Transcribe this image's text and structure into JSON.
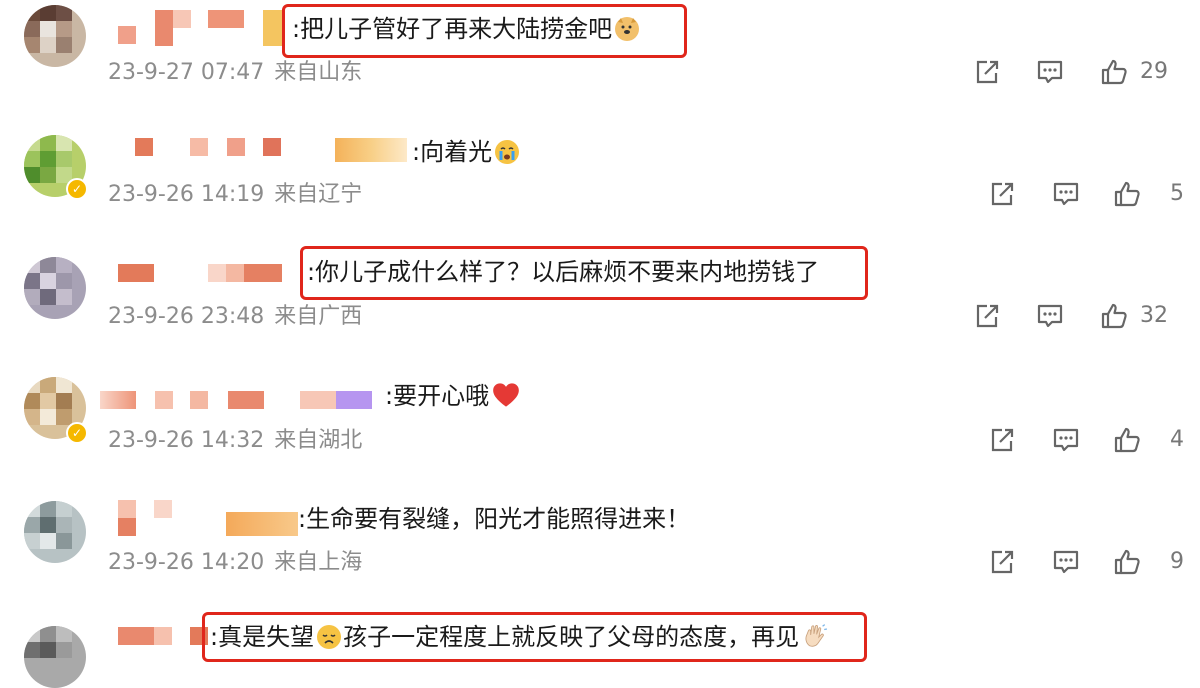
{
  "comments": [
    {
      "text": ":把儿子管好了再来大陆捞金吧",
      "emoji": "doge-emoji",
      "time": "23-9-27 07:47",
      "location": "来自山东",
      "likes": "29"
    },
    {
      "text": ":向着光",
      "emoji": "crying-face-emoji",
      "time": "23-9-26 14:19",
      "location": "来自辽宁",
      "likes": "5"
    },
    {
      "text": ":你儿子成什么样了？以后麻烦不要来内地捞钱了",
      "emoji": "",
      "time": "23-9-26 23:48",
      "location": "来自广西",
      "likes": "32"
    },
    {
      "text": ":要开心哦",
      "emoji": "red-heart-emoji",
      "time": "23-9-26 14:32",
      "location": "来自湖北",
      "likes": "4"
    },
    {
      "text": ":生命要有裂缝，阳光才能照得进来！",
      "emoji": "",
      "time": "23-9-26 14:20",
      "location": "来自上海",
      "likes": "9"
    },
    {
      "text_a": ":真是失望",
      "text_b": "孩子一定程度上就反映了父母的态度，再见",
      "emoji_a": "disappointed-face-emoji",
      "emoji_b": "waving-hand-emoji"
    }
  ],
  "colors": {
    "highlight": "#e0261b",
    "meta": "#8c8c8c",
    "verified": "#f5b800"
  }
}
